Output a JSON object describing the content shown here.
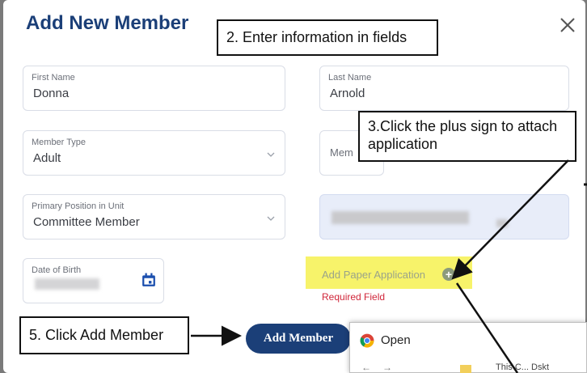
{
  "modal": {
    "title": "Add New Member",
    "close_icon": "close-icon"
  },
  "fields": {
    "first_name": {
      "label": "First Name",
      "value": "Donna"
    },
    "last_name": {
      "label": "Last Name",
      "value": "Arnold"
    },
    "member_type": {
      "label": "Member Type",
      "value": "Adult"
    },
    "member_partial": {
      "value": "Mem"
    },
    "primary_position": {
      "label": "Primary Position in Unit",
      "value": "Committee Member"
    },
    "dob": {
      "label": "Date of Birth"
    }
  },
  "paper_application": {
    "label": "Add Paper Application",
    "required": "Required Field"
  },
  "add_member_button": "Add Member",
  "open_window": {
    "title": "Open",
    "partial_path": "This C... Dskt"
  },
  "callouts": {
    "step2": "2. Enter information in fields",
    "step3": "3.Click the plus sign to attach application",
    "step5": "5. Click Add Member"
  },
  "colors": {
    "brand": "#1b3f78",
    "highlight": "#f7f36a",
    "error": "#d0263a"
  }
}
